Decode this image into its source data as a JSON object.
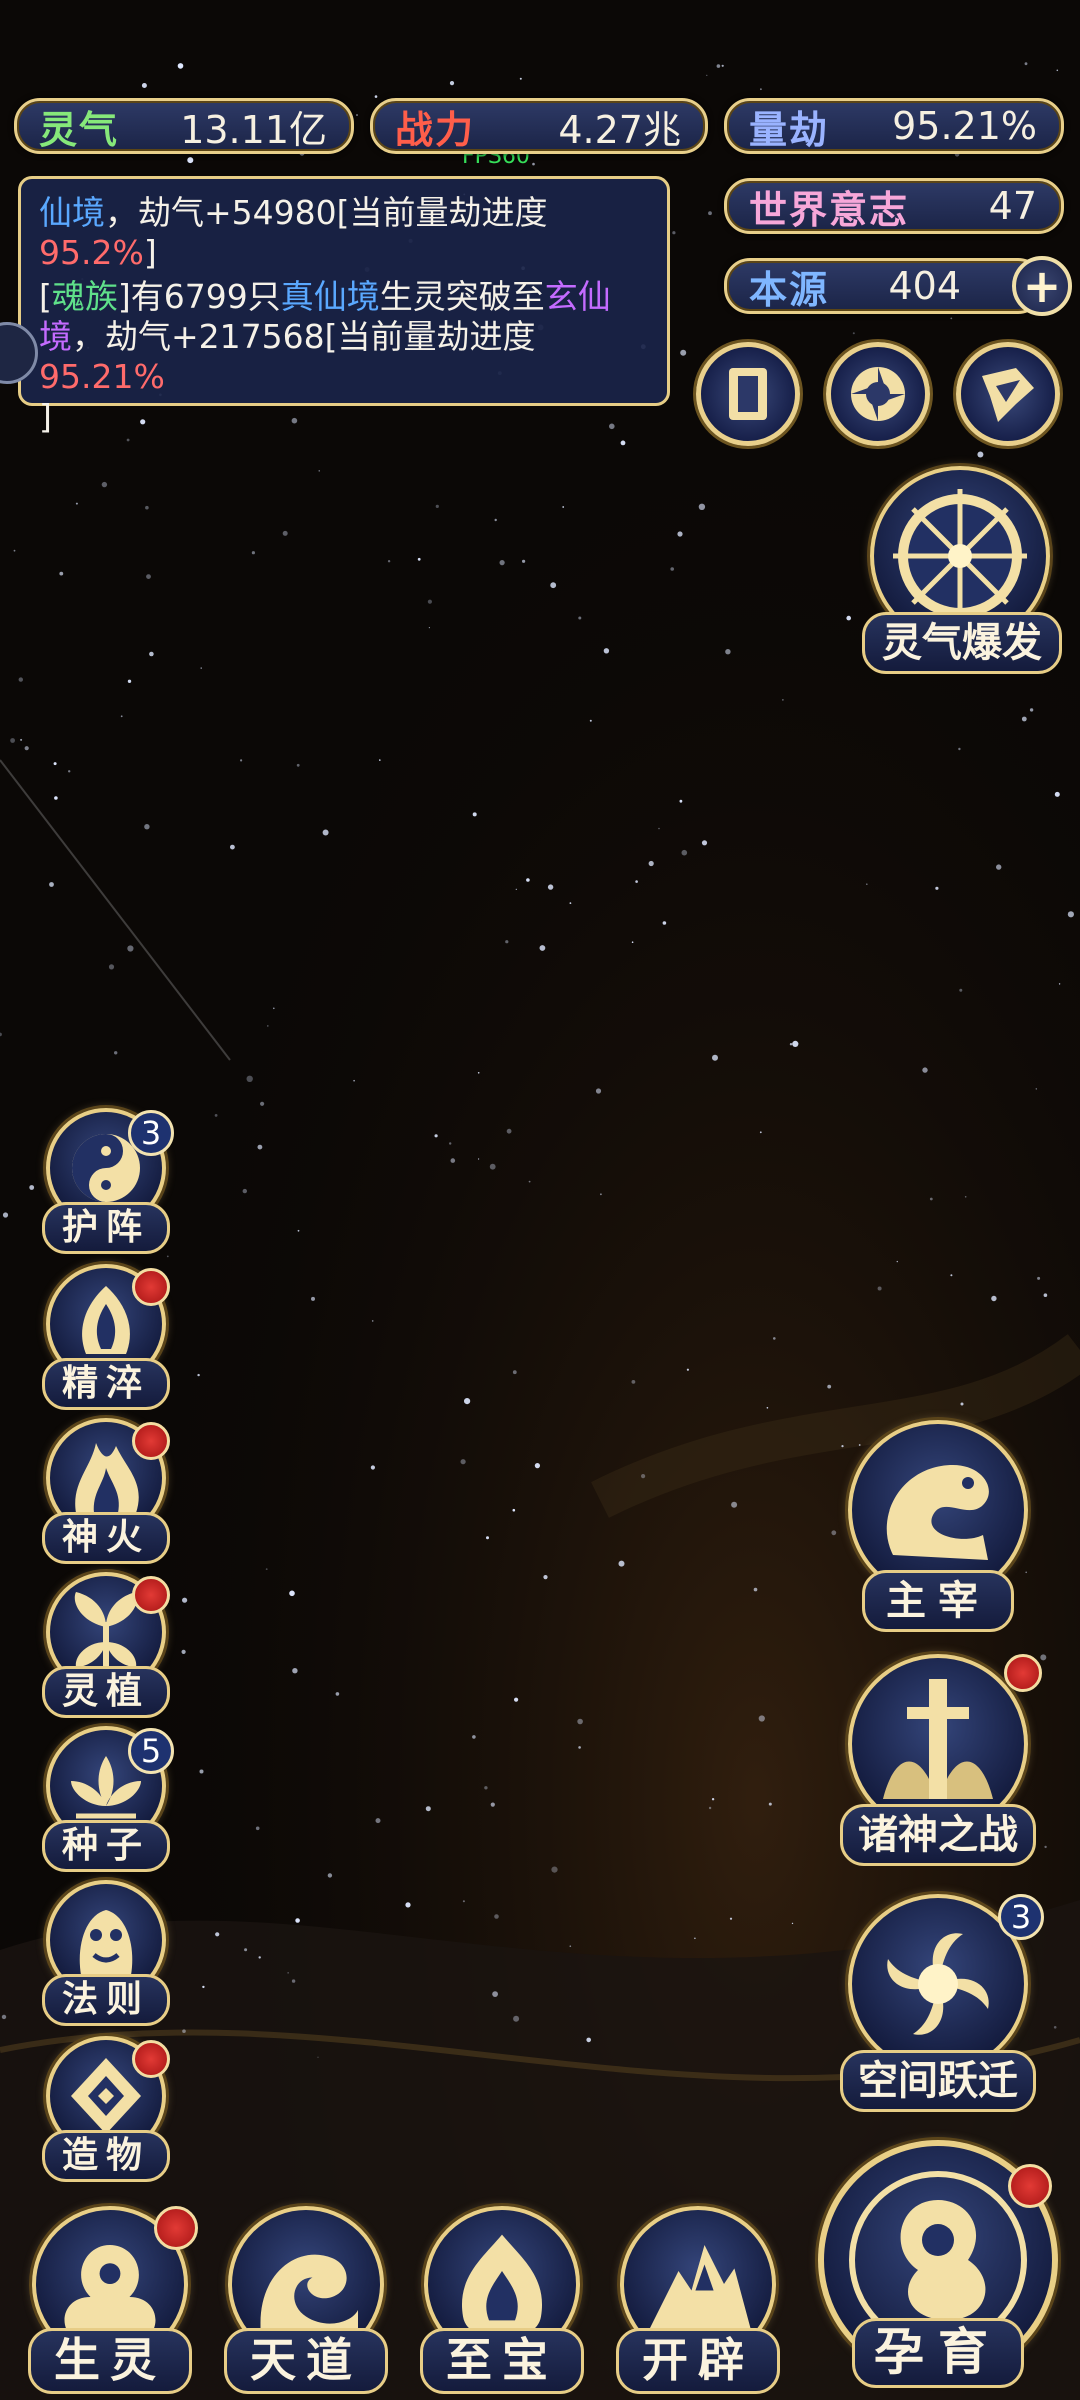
{
  "fps": "FPS60",
  "stats": {
    "lingqi": {
      "label": "灵气",
      "value": "13.11亿"
    },
    "zhanli": {
      "label": "战力",
      "value": "4.27兆"
    },
    "liangjie": {
      "label": "量劫",
      "value": "95.21%"
    },
    "shijie": {
      "label": "世界意志",
      "value": "47"
    },
    "benyuan": {
      "label": "本源",
      "value": "404",
      "plus": "+"
    }
  },
  "log": {
    "line1": {
      "a": "仙境",
      "b": "，劫气+54980[当前量劫进度",
      "c": "95.2%",
      "d": "]"
    },
    "line2": {
      "a": "[",
      "b": "魂族",
      "c": "]有6799只",
      "d": "真仙境",
      "e": "生灵突破至",
      "f": "玄仙",
      "g": "境",
      "h": "，劫气+217568[当前量劫进度",
      "i": "95.21%",
      "j": "]"
    }
  },
  "top_icons": [
    "card-icon",
    "vortex-icon",
    "flag-icon"
  ],
  "right_buttons": {
    "burst": "灵气爆发",
    "master": "主宰",
    "war": "诸神之战",
    "warp": "空间跃迁",
    "warp_badge": "3"
  },
  "left_menu": [
    {
      "label": "护阵",
      "badge": "3",
      "icon": "taiji-icon"
    },
    {
      "label": "精淬",
      "dot": true,
      "icon": "flame-crystal-icon"
    },
    {
      "label": "神火",
      "dot": true,
      "icon": "divine-fire-icon"
    },
    {
      "label": "灵植",
      "dot": true,
      "icon": "spirit-plant-icon"
    },
    {
      "label": "种子",
      "badge": "5",
      "icon": "seed-lotus-icon"
    },
    {
      "label": "法则",
      "icon": "law-totem-icon"
    },
    {
      "label": "造物",
      "dot": true,
      "icon": "creation-gem-icon"
    }
  ],
  "bottom_nav": [
    {
      "label": "生灵",
      "dot": true,
      "icon": "phoenix-icon"
    },
    {
      "label": "天道",
      "icon": "wave-icon"
    },
    {
      "label": "至宝",
      "icon": "treasure-flame-icon"
    },
    {
      "label": "开辟",
      "icon": "mountain-icon"
    }
  ],
  "nurture": {
    "label": "孕育",
    "dot": true
  }
}
